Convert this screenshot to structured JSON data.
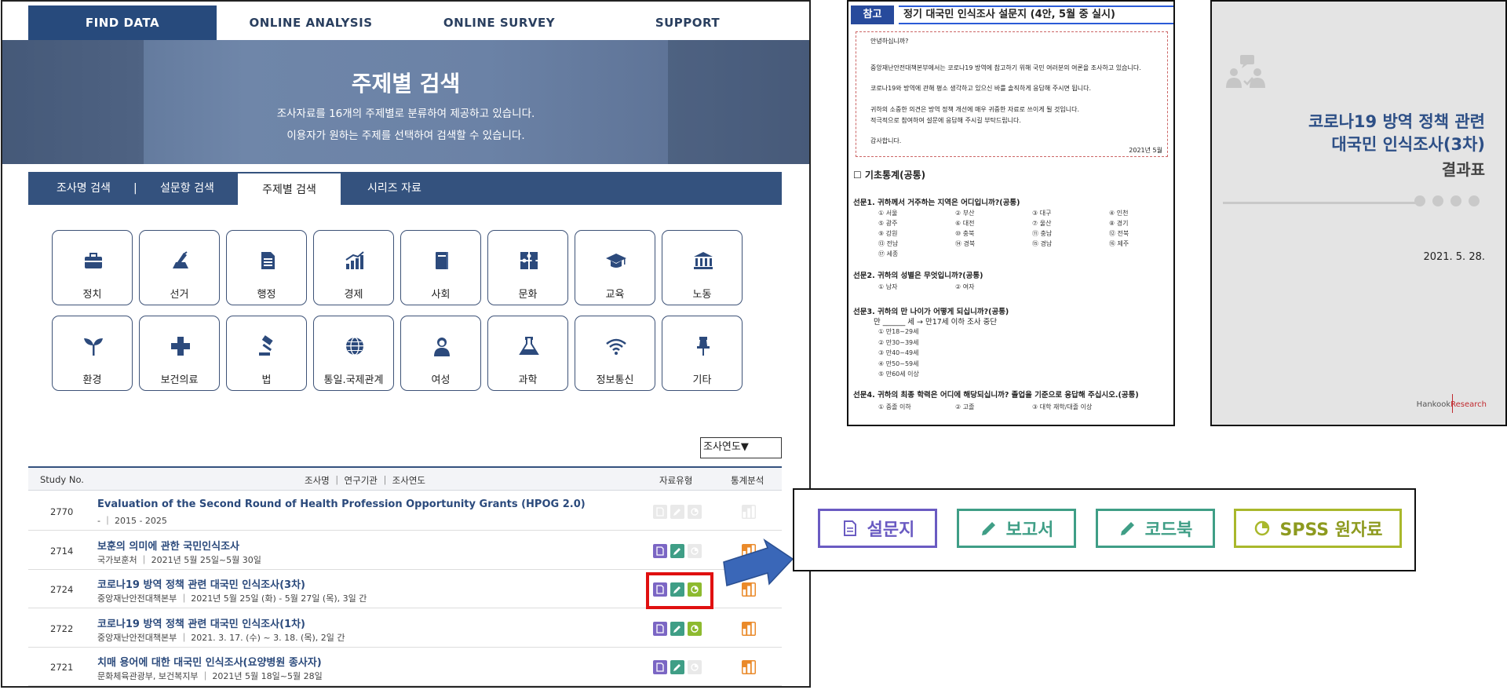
{
  "nav": {
    "items": [
      "FIND DATA",
      "ONLINE ANALYSIS",
      "ONLINE SURVEY",
      "SUPPORT"
    ]
  },
  "banner": {
    "title": "주제별 검색",
    "line1": "조사자료를 16개의 주제별로 분류하여 제공하고 있습니다.",
    "line2": "이용자가 원하는 주제를 선택하여 검색할 수 있습니다."
  },
  "sub_tabs": {
    "items": [
      "조사명 검색",
      "설문항 검색",
      "주제별 검색",
      "시리즈 자료"
    ],
    "separator": "|"
  },
  "categories": [
    {
      "label": "정치",
      "icon": "briefcase-icon"
    },
    {
      "label": "선거",
      "icon": "ballot-icon"
    },
    {
      "label": "행정",
      "icon": "document-icon"
    },
    {
      "label": "경제",
      "icon": "bar-growth-icon"
    },
    {
      "label": "사회",
      "icon": "book-icon"
    },
    {
      "label": "문화",
      "icon": "puzzle-icon"
    },
    {
      "label": "교육",
      "icon": "graduation-cap-icon"
    },
    {
      "label": "노동",
      "icon": "bank-icon"
    },
    {
      "label": "환경",
      "icon": "sprout-icon"
    },
    {
      "label": "보건의료",
      "icon": "medical-cross-icon"
    },
    {
      "label": "법",
      "icon": "gavel-icon"
    },
    {
      "label": "통일.국제관계",
      "icon": "globe-icon"
    },
    {
      "label": "여성",
      "icon": "woman-icon"
    },
    {
      "label": "과학",
      "icon": "flask-icon"
    },
    {
      "label": "정보통신",
      "icon": "wifi-icon"
    },
    {
      "label": "기타",
      "icon": "pushpin-icon"
    }
  ],
  "year_select": {
    "label": "조사연도▼"
  },
  "table": {
    "headers": {
      "study_no": "Study No.",
      "title": "조사명 ｜ 연구기관 ｜ 조사연도",
      "type": "자료유형",
      "stat": "통계분석"
    },
    "rows": [
      {
        "no": "2770",
        "title": "Evaluation of the Second Round of Health Profession Opportunity Grants (HPOG 2.0)",
        "meta": "- ｜ 2015 - 2025",
        "q": false,
        "r": false,
        "s": false,
        "stat": false
      },
      {
        "no": "2714",
        "title": "보훈의 의미에 관한 국민인식조사",
        "meta": "국가보훈처 ｜ 2021년 5월 25일~5월 30일",
        "q": true,
        "r": true,
        "s": false,
        "stat": true
      },
      {
        "no": "2724",
        "title": "코로나19 방역 정책 관련 대국민 인식조사(3차)",
        "meta": "중앙재난안전대책본부 ｜ 2021년 5월 25일 (화) - 5월 27일 (목), 3일 간",
        "q": true,
        "r": true,
        "s": true,
        "stat": true
      },
      {
        "no": "2722",
        "title": "코로나19 방역 정책 관련 대국민 인식조사(1차)",
        "meta": "중앙재난안전대책본부 ｜ 2021. 3. 17. (수) ~ 3. 18. (목), 2일 간",
        "q": true,
        "r": true,
        "s": true,
        "stat": true
      },
      {
        "no": "2721",
        "title": "치매 용어에 대한 대국민 인식조사(요양병원 종사자)",
        "meta": "문화체육관광부, 보건복지부 ｜ 2021년 5월 18일~5월 28일",
        "q": true,
        "r": true,
        "s": false,
        "stat": true
      }
    ]
  },
  "legend": {
    "questionnaire": "설문지",
    "report": "보고서",
    "codebook": "코드북",
    "spss": "SPSS 원자료",
    "colors": {
      "questionnaire": "#6a5bc2",
      "report": "#3f9e86",
      "codebook": "#3f9e86",
      "spss": "#a9b82c"
    }
  },
  "questionnaire_doc": {
    "tag": "참고",
    "title": "정기 대국민 인식조사 설문지 (4안, 5월 중 실시)",
    "intro": [
      "안녕하십니까?",
      "중앙재난안전대책본부에서는 코로나19 방역에 참고하기 위해 국민 여러분의 여론을 조사하고 있습니다.",
      "코로나19와 방역에 관해 평소 생각하고 있으신 바를 솔직하게 응답해 주시면 됩니다.",
      "귀하의 소중한 의견은 방역 정책 개선에 매우 귀중한 자료로 쓰이게 될 것입니다.",
      "적극적으로 참여하여 설문에 응답해 주시길 부탁드립니다.",
      "감사합니다."
    ],
    "date": "2021년 5월",
    "section": "☐ 기초통계(공통)",
    "q1": "선문1. 귀하께서 거주하는 지역은 어디입니까?(공통)",
    "q1_options": [
      "① 서울",
      "② 부산",
      "③ 대구",
      "④ 인천",
      "⑤ 광주",
      "⑥ 대전",
      "⑦ 울산",
      "⑧ 경기",
      "⑨ 강원",
      "⑩ 충북",
      "⑪ 충남",
      "⑫ 전북",
      "⑬ 전남",
      "⑭ 경북",
      "⑮ 경남",
      "⑯ 제주",
      "⑰ 세종"
    ],
    "q2": "선문2. 귀하의 성별은 무엇입니까?(공통)",
    "q2_options": [
      "① 남자",
      "② 여자"
    ],
    "q3": "선문3. 귀하의 만 나이가 어떻게 되십니까?(공통)",
    "q3_line": "만 ______ 세   → 만17세 이하 조사 중단",
    "q3_options": [
      "① 만18~29세",
      "② 만30~39세",
      "③ 만40~49세",
      "④ 만50~59세",
      "⑤ 만60세 이상"
    ],
    "q4": "선문4. 귀하의 최종 학력은 어디에 해당되십니까? 졸업을 기준으로 응답해 주십시오.(공통)",
    "q4_options": [
      "① 중졸 이하",
      "② 고졸",
      "③ 대학 재학/대졸 이상"
    ]
  },
  "report_doc": {
    "title1": "코로나19 방역 정책 관련",
    "title2": "대국민 인식조사(3차)",
    "title3": "결과표",
    "date": "2021. 5. 28.",
    "brand_a": "Hankook",
    "brand_b": "Research"
  }
}
